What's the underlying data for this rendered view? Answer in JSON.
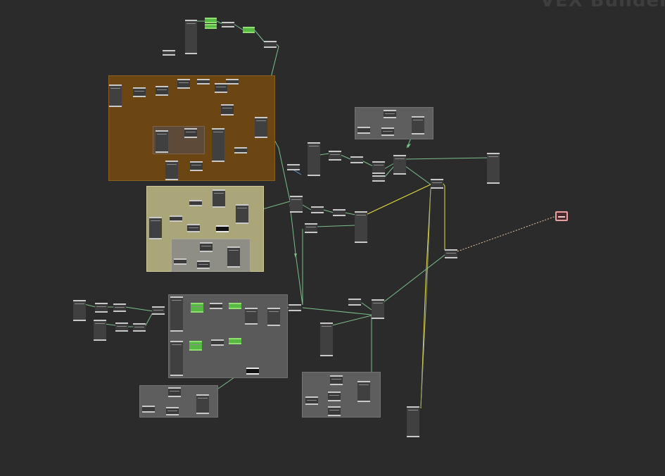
{
  "canvas": {
    "title": "VEX Builder",
    "background": "#2b2b2b",
    "colors": {
      "wire_default": "#7ac08a",
      "wire_blue": "#5aa0d8",
      "wire_yellow": "#e8e040",
      "wire_olive": "#8a8a40",
      "wire_dashed": "#e8c8a8",
      "frame_orange": "#6b4612",
      "frame_yellow": "#aaa67a",
      "frame_gray": "#5a5a5a",
      "node_green": "#57b843",
      "node_error_pink": "#e8a0a0"
    }
  },
  "frames": [
    {
      "name": "network-box-orange",
      "color": "#6b4612",
      "border": "#8a5e1e"
    },
    {
      "name": "network-box-orange-inner",
      "color": "#5d4a38",
      "border": "#7a6650"
    },
    {
      "name": "network-box-yellow",
      "color": "#aaa67a",
      "border": "#cfcb98"
    },
    {
      "name": "network-box-yellow-inner",
      "color": "#8f8e84",
      "border": "#a8a79c"
    },
    {
      "name": "network-box-gray-main",
      "color": "#5a5a5a",
      "border": "#6f6f6f"
    },
    {
      "name": "network-box-gray-top-right",
      "color": "#5e5e5e",
      "border": "#727272"
    },
    {
      "name": "network-box-gray-bottom-left",
      "color": "#5e5e5e",
      "border": "#727272"
    },
    {
      "name": "network-box-gray-bottom-right",
      "color": "#5e5e5e",
      "border": "#727272"
    }
  ],
  "node_count": 118
}
